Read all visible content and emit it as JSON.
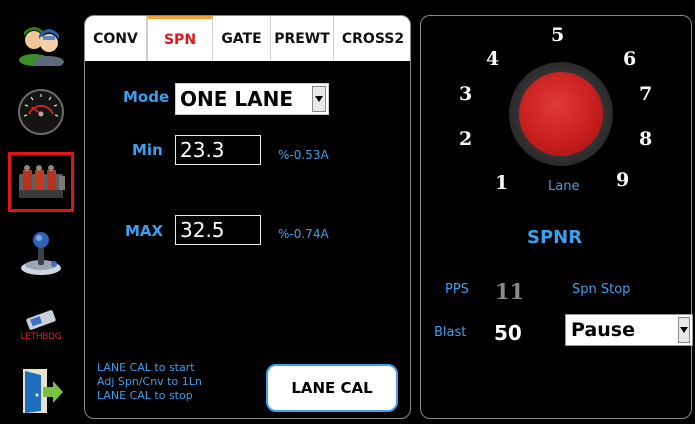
{
  "rail": {
    "items": [
      {
        "name": "operators-icon"
      },
      {
        "name": "gauge-icon"
      },
      {
        "name": "valve-block-icon",
        "selected": true
      },
      {
        "name": "joystick-icon"
      },
      {
        "name": "lethbdg-icon",
        "label": "LETHBDG"
      },
      {
        "name": "exit-door-icon"
      }
    ],
    "selected_outline_color": "#e0141a"
  },
  "tabs": [
    {
      "label": "CONV",
      "active": false
    },
    {
      "label": "SPN",
      "active": true
    },
    {
      "label": "GATE",
      "active": false
    },
    {
      "label": "PREWT",
      "active": false
    },
    {
      "label": "CROSS2",
      "active": false
    }
  ],
  "mode": {
    "label": "Mode",
    "value": "ONE LANE"
  },
  "min": {
    "label": "Min",
    "value": "23.3",
    "unit": "%-0.53A"
  },
  "max": {
    "label": "MAX",
    "value": "32.5",
    "unit": "%-0.74A"
  },
  "hint": {
    "line1": "LANE CAL to start",
    "line2": "Adj Spn/Cnv to 1Ln",
    "line3": "LANE CAL to stop"
  },
  "lane_cal_button": "LANE CAL",
  "dial": {
    "numbers": [
      "1",
      "2",
      "3",
      "4",
      "5",
      "6",
      "7",
      "8",
      "9"
    ],
    "label": "Lane",
    "knob_color": "#c51d1d"
  },
  "spnr_title": "SPNR",
  "pps": {
    "label": "PPS",
    "value": "11"
  },
  "spn_stop": {
    "label": "Spn Stop"
  },
  "blast": {
    "label": "Blast",
    "value": "50"
  },
  "pause_select": {
    "value": "Pause"
  },
  "colors": {
    "accent_blue": "#3aa0f0",
    "active_tab_red": "#e0141a",
    "active_tab_top": "#f2a33a"
  }
}
